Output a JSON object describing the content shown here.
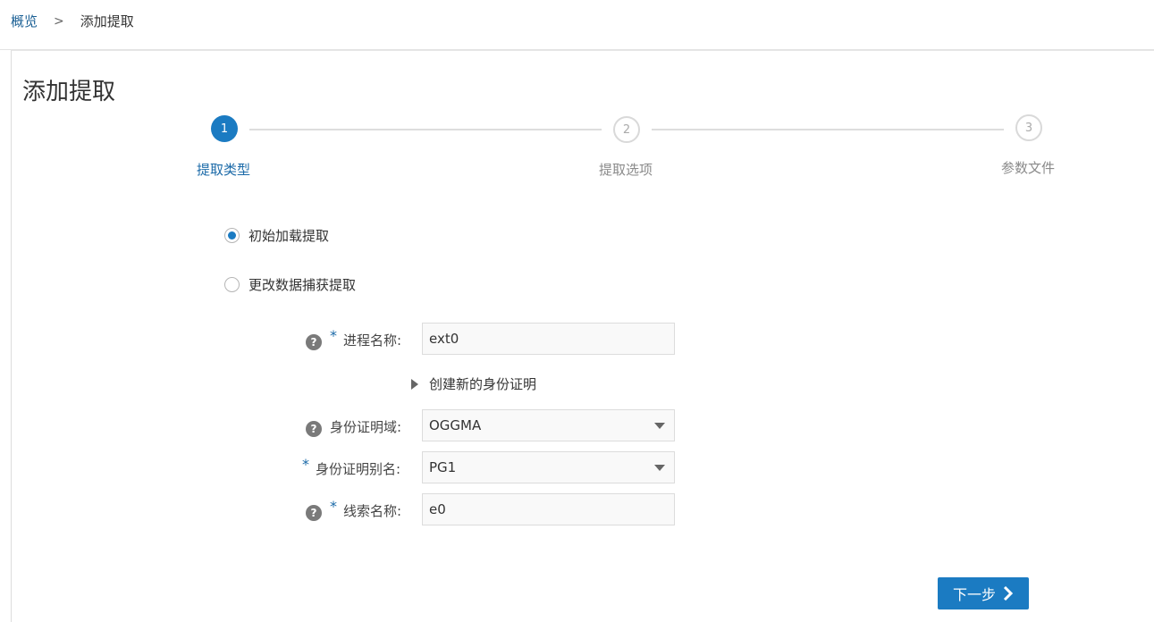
{
  "breadcrumb": {
    "home": "概览",
    "separator": ">",
    "current": "添加提取"
  },
  "page": {
    "title": "添加提取"
  },
  "steps": [
    {
      "number": "1",
      "label": "提取类型",
      "state": "active"
    },
    {
      "number": "2",
      "label": "提取选项",
      "state": "inactive"
    },
    {
      "number": "3",
      "label": "参数文件",
      "state": "inactive"
    }
  ],
  "extract_type": {
    "options": [
      {
        "label": "初始加载提取",
        "selected": true
      },
      {
        "label": "更改数据捕获提取",
        "selected": false
      }
    ]
  },
  "form": {
    "process_name": {
      "label": "进程名称:",
      "value": "ext0",
      "required": "*"
    },
    "create_credential": {
      "label": "创建新的身份证明"
    },
    "credential_domain": {
      "label": "身份证明域:",
      "value": "OGGMA"
    },
    "credential_alias": {
      "label": "身份证明别名:",
      "value": "PG1",
      "required": "*"
    },
    "trail_name": {
      "label": "线索名称:",
      "value": "e0",
      "required": "*"
    }
  },
  "help_glyph": "?",
  "actions": {
    "next_label": "下一步"
  },
  "colors": {
    "accent": "#1b7bc2",
    "link": "#1a5f94",
    "help_icon": "#7a7a7a"
  }
}
